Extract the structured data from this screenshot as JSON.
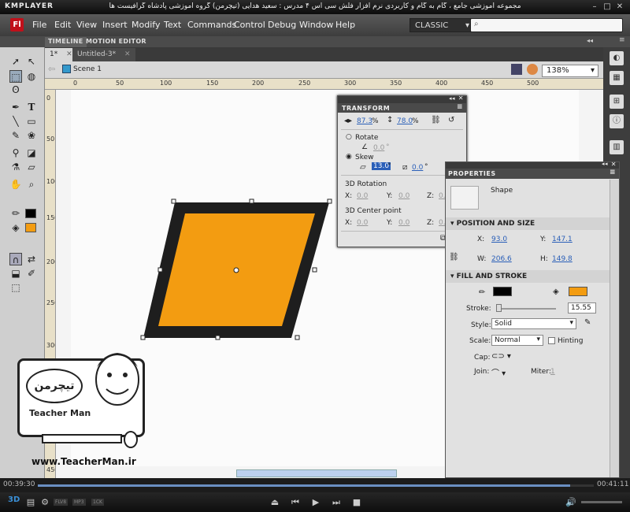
{
  "player": {
    "logo": "KMPLAYER",
    "caption": "مجموعه آموزشی جامع ، گام به گام و کاربردی نرم افزار فلش سی اس ۴ مدرس : سعید هدایی (تیچرمن) گروه آموزشی پادشاه گرافیست ها",
    "time_elapsed": "00:39:30",
    "time_total": "00:41:11",
    "badges": [
      "FLV8",
      "MP3",
      "1CK"
    ],
    "progress": 0.958
  },
  "menubar": {
    "app_icon": "Fl",
    "items": [
      "File",
      "Edit",
      "View",
      "Insert",
      "Modify",
      "Text",
      "Commands",
      "Control",
      "Debug",
      "Window",
      "Help"
    ],
    "workspace": "CLASSIC",
    "search_placeholder": ""
  },
  "panel_tabs": [
    "TIMELINE",
    "MOTION EDITOR"
  ],
  "documents": [
    "1*",
    "Untitled-3*"
  ],
  "editbar": {
    "scene": "Scene 1",
    "zoom": "138%"
  },
  "rulers": {
    "top": [
      "0",
      "50",
      "100",
      "150",
      "200",
      "250",
      "300",
      "350",
      "400",
      "450",
      "500"
    ],
    "left": [
      "0",
      "50",
      "100",
      "150",
      "200",
      "250",
      "300",
      "350",
      "400",
      "450"
    ]
  },
  "transform": {
    "title": "TRANSFORM",
    "width": "87.3",
    "height": "78.0",
    "percent": "%",
    "rotate_label": "Rotate",
    "rotate_value": "0.0",
    "skew_label": "Skew",
    "skew_h": "13.0",
    "skew_v": "0.0",
    "deg": "°",
    "rot3d_label": "3D Rotation",
    "rot3d": {
      "x": "0.0",
      "y": "0.0",
      "z": "0.0"
    },
    "center3d_label": "3D Center point",
    "center3d": {
      "x": "0.0",
      "y": "0.0",
      "z": "0.0"
    },
    "x_label": "X:",
    "y_label": "Y:",
    "z_label": "Z:"
  },
  "properties": {
    "title": "PROPERTIES",
    "type": "Shape",
    "pos_section": "POSITION AND SIZE",
    "x": "93.0",
    "y": "147.1",
    "w": "206.6",
    "h": "149.8",
    "x_label": "X:",
    "y_label": "Y:",
    "w_label": "W:",
    "h_label": "H:",
    "fill_section": "FILL AND STROKE",
    "stroke_label": "Stroke:",
    "stroke_value": "15.55",
    "style_label": "Style:",
    "style_value": "Solid",
    "scale_label": "Scale:",
    "scale_value": "Normal",
    "hinting_label": "Hinting",
    "cap_label": "Cap:",
    "join_label": "Join:",
    "miter_label": "Miter:",
    "miter_value": "1"
  },
  "colors": {
    "fill": "#f39c11",
    "stroke": "#1e1e1e",
    "accent": "#2a5fb8"
  },
  "watermark": {
    "brand_fa": "تیچرمن",
    "brand_en": "Teacher Man",
    "url": "www.TeacherMan.ir"
  }
}
